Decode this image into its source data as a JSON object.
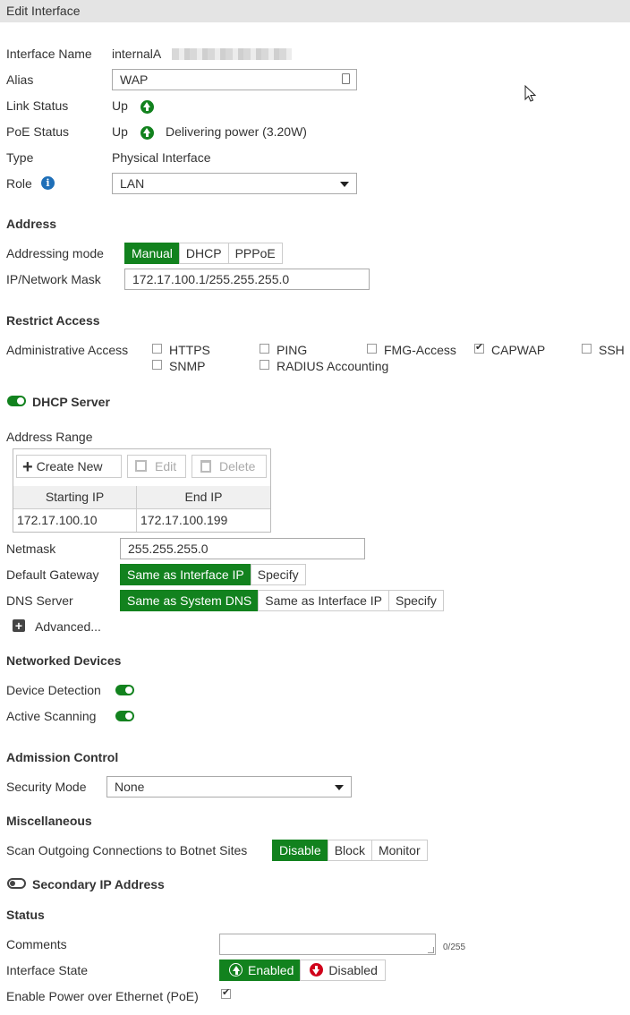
{
  "window": {
    "title": "Edit Interface"
  },
  "interface": {
    "name_label": "Interface Name",
    "name_value": "internalA",
    "alias_label": "Alias",
    "alias_value": "WAP",
    "link_status_label": "Link Status",
    "link_status_value": "Up",
    "poe_status_label": "PoE Status",
    "poe_status_value": "Up",
    "poe_status_detail": "Delivering power (3.20W)",
    "type_label": "Type",
    "type_value": "Physical Interface",
    "role_label": "Role",
    "role_value": "LAN"
  },
  "address": {
    "heading": "Address",
    "mode_label": "Addressing mode",
    "modes": [
      "Manual",
      "DHCP",
      "PPPoE"
    ],
    "mode_selected": "Manual",
    "ipmask_label": "IP/Network Mask",
    "ipmask_value": "172.17.100.1/255.255.255.0"
  },
  "restrict": {
    "heading": "Restrict Access",
    "admin_label": "Administrative Access",
    "options": [
      {
        "label": "HTTPS",
        "checked": false
      },
      {
        "label": "PING",
        "checked": false
      },
      {
        "label": "FMG-Access",
        "checked": false
      },
      {
        "label": "CAPWAP",
        "checked": true
      },
      {
        "label": "SSH",
        "checked": false
      },
      {
        "label": "SNMP",
        "checked": false
      },
      {
        "label": "RADIUS Accounting",
        "checked": false
      }
    ]
  },
  "dhcp": {
    "heading": "DHCP Server",
    "enabled": true,
    "range_label": "Address Range",
    "toolbar": {
      "create": "Create New",
      "edit": "Edit",
      "delete": "Delete"
    },
    "columns": [
      "Starting IP",
      "End IP"
    ],
    "rows": [
      {
        "start": "172.17.100.10",
        "end": "172.17.100.199"
      }
    ],
    "netmask_label": "Netmask",
    "netmask_value": "255.255.255.0",
    "gateway_label": "Default Gateway",
    "gateway_options": [
      "Same as Interface IP",
      "Specify"
    ],
    "gateway_selected": "Same as Interface IP",
    "dns_label": "DNS Server",
    "dns_options": [
      "Same as System DNS",
      "Same as Interface IP",
      "Specify"
    ],
    "dns_selected": "Same as System DNS",
    "advanced_label": "Advanced..."
  },
  "networked": {
    "heading": "Networked Devices",
    "detection_label": "Device Detection",
    "detection_on": true,
    "scanning_label": "Active Scanning",
    "scanning_on": true
  },
  "admission": {
    "heading": "Admission Control",
    "security_label": "Security Mode",
    "security_value": "None"
  },
  "misc": {
    "heading": "Miscellaneous",
    "botnet_label": "Scan Outgoing Connections to Botnet Sites",
    "botnet_options": [
      "Disable",
      "Block",
      "Monitor"
    ],
    "botnet_selected": "Disable"
  },
  "secondary": {
    "heading": "Secondary IP Address",
    "enabled": false
  },
  "status": {
    "heading": "Status",
    "comments_label": "Comments",
    "comments_value": "",
    "comments_count": "0/255",
    "state_label": "Interface State",
    "state_enabled": "Enabled",
    "state_disabled": "Disabled",
    "state_selected": "Enabled",
    "poe_label": "Enable Power over Ethernet (PoE)",
    "poe_checked": true
  },
  "colors": {
    "accent": "#12821e",
    "danger": "#d0021b",
    "info": "#1e6fb8"
  }
}
